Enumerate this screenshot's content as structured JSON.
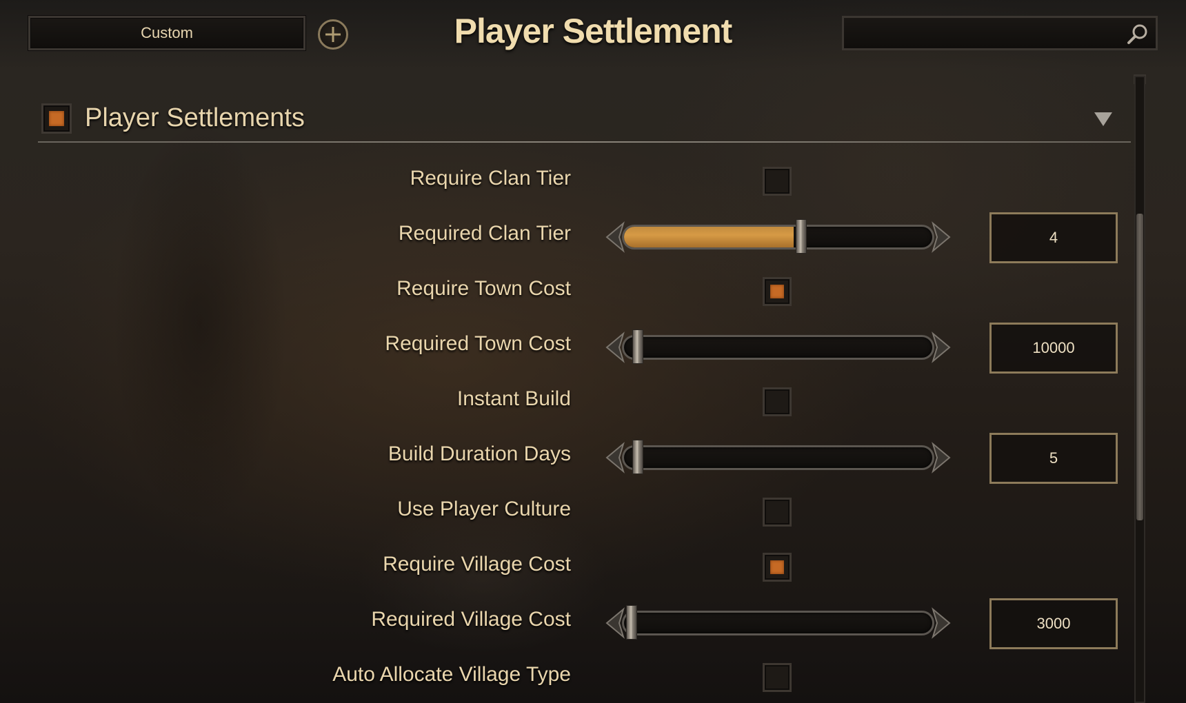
{
  "header": {
    "preset_label": "Custom",
    "title": "Player Settlement",
    "search_value": ""
  },
  "section": {
    "title": "Player Settlements",
    "enabled": true
  },
  "rows": [
    {
      "label": "Require Clan Tier",
      "type": "checkbox",
      "checked": false
    },
    {
      "label": "Required Clan Tier",
      "type": "slider",
      "fraction": 0.55,
      "value": "4"
    },
    {
      "label": "Require Town Cost",
      "type": "checkbox",
      "checked": true
    },
    {
      "label": "Required Town Cost",
      "type": "slider",
      "fraction": 0.02,
      "value": "10000"
    },
    {
      "label": "Instant Build",
      "type": "checkbox",
      "checked": false
    },
    {
      "label": "Build Duration Days",
      "type": "slider",
      "fraction": 0.02,
      "value": "5"
    },
    {
      "label": "Use Player Culture",
      "type": "checkbox",
      "checked": false
    },
    {
      "label": "Require Village Cost",
      "type": "checkbox",
      "checked": true
    },
    {
      "label": "Required Village Cost",
      "type": "slider",
      "fraction": 0.0,
      "value": "3000"
    },
    {
      "label": "Auto Allocate Village Type",
      "type": "checkbox",
      "checked": false
    }
  ],
  "colors": {
    "accent_orange": "#c66a25",
    "slider_fill": "#d69a45",
    "text": "#ead6ad"
  },
  "icons": [
    "add-icon",
    "search-icon",
    "collapse-triangle-icon"
  ]
}
